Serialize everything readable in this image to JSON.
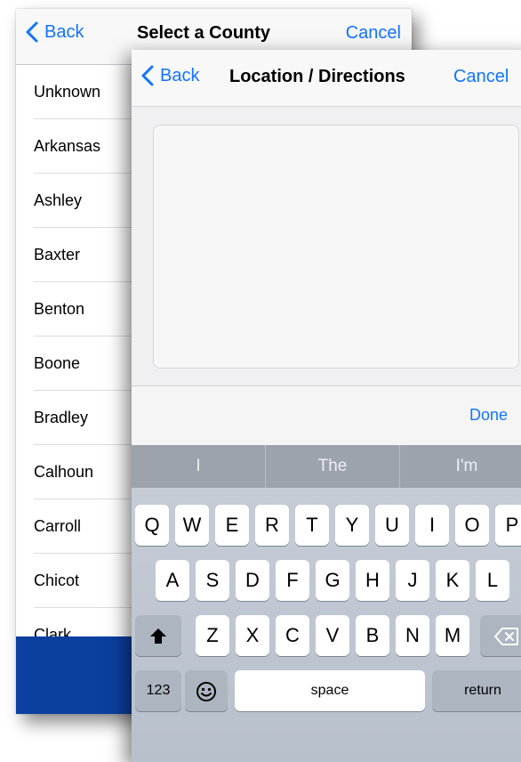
{
  "back_screen": {
    "nav": {
      "back_label": "Back",
      "title": "Select a County",
      "cancel_label": "Cancel"
    },
    "counties": [
      "Unknown",
      "Arkansas",
      "Ashley",
      "Baxter",
      "Benton",
      "Boone",
      "Bradley",
      "Calhoun",
      "Carroll",
      "Chicot",
      "Clark"
    ]
  },
  "front_screen": {
    "nav": {
      "back_label": "Back",
      "title": "Location / Directions",
      "cancel_label": "Cancel"
    },
    "textarea_value": "",
    "done_label": "Done",
    "suggestions": [
      "I",
      "The",
      "I'm"
    ],
    "keyboard": {
      "row1": [
        "Q",
        "W",
        "E",
        "R",
        "T",
        "Y",
        "U",
        "I",
        "O",
        "P"
      ],
      "row2": [
        "A",
        "S",
        "D",
        "F",
        "G",
        "H",
        "J",
        "K",
        "L"
      ],
      "row3": [
        "Z",
        "X",
        "C",
        "V",
        "B",
        "N",
        "M"
      ],
      "numbers_label": "123",
      "space_label": "space",
      "return_label": "return"
    }
  },
  "colors": {
    "accent": "#1174ff",
    "bottom_bar": "#0b3fa0"
  }
}
